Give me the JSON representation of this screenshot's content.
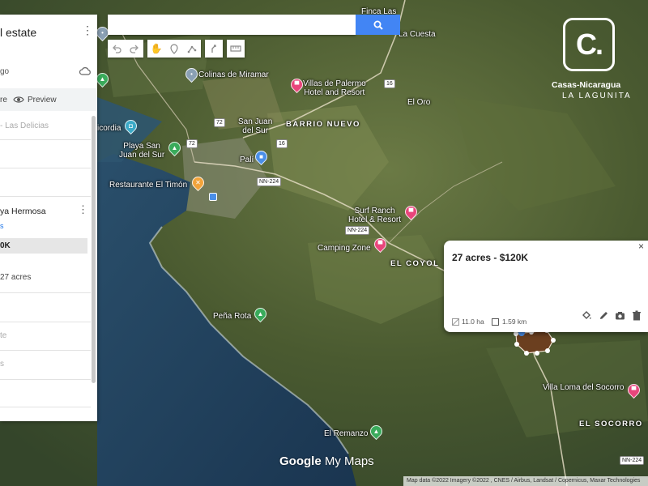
{
  "panel": {
    "title_fragment": "l estate",
    "subtitle_fragment": "go",
    "share_fragment": "re",
    "preview_label": "Preview",
    "layer_fragment": "- Las Delicias",
    "item_title_fragment": "ya Hermosa",
    "item_sub_fragment": "s",
    "item_selected_fragment": "0K",
    "item_acres_fragment": "27 acres",
    "item_te_fragment": "te",
    "item_s_fragment": "s"
  },
  "search": {
    "placeholder": ""
  },
  "brand": {
    "name": "Casas-Nicaragua",
    "tagline": "LA LAGUNITA",
    "logo_letter": "C."
  },
  "info_window": {
    "title": "27 acres - $120K",
    "area": "11.0 ha",
    "perimeter": "1.59 km",
    "close": "×"
  },
  "places": {
    "finca": "Finca Las",
    "la_cuesta": "La Cuesta",
    "colinas": "Colinas de Miramar",
    "villas": "Villas de Palermo\nHotel and Resort",
    "el_oro": "El Oro",
    "san_juan": "San Juan\ndel Sur",
    "barrio_nuevo": "BARRIO NUEVO",
    "misericordia": "icordia",
    "playa_san_juan": "Playa San\nJuan del Sur",
    "pali": "Palí",
    "timon": "Restaurante El Timón",
    "surf_ranch": "Surf Ranch\nHotel & Resort",
    "camping": "Camping Zone",
    "el_coyol": "EL COYOL",
    "pena_rota": "Peña Rota",
    "villa_loma": "Villa Loma del Socorro",
    "el_socorro": "EL SOCORRO",
    "el_remanzo": "El Remanzo"
  },
  "roads": {
    "r16a": "16",
    "r16b": "16",
    "r72a": "72",
    "r72b": "72",
    "nn224a": "NN-224",
    "nn224b": "NN-224",
    "nn224c": "NN-224"
  },
  "watermark": {
    "google": "Google",
    "mymaps": " My Maps"
  },
  "attribution": "Map data ©2022 Imagery ©2022 , CNES / Airbus, Landsat / Copernicus, Maxar Technologies",
  "colors": {
    "accent": "#4285f4",
    "pin_pink": "#e8457b",
    "pin_green": "#3aab5b",
    "pin_blue": "#4a8fe8",
    "pin_orange": "#f2a33a",
    "pin_gray": "#8aa0b4",
    "parcel_fill": "#6b3f1f"
  }
}
